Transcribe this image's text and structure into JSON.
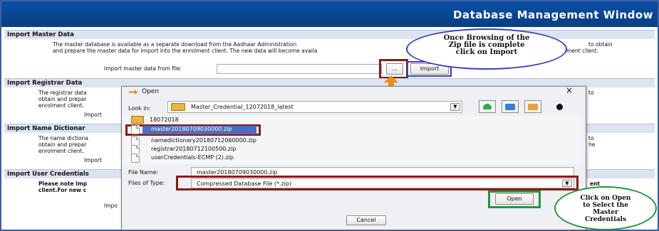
{
  "window": {
    "title": "Database Management Window"
  },
  "sections": {
    "master": {
      "heading": "Import Master Data",
      "desc1": "The master database is available as a separate download from the Aadhaar Administration",
      "desc1b": "to obtain",
      "desc2": "and prepare the master data for import into the enrolment client. The new data will become availa",
      "desc2b": "lment client.",
      "label": "Import master data from file:",
      "browse_label": "...",
      "import_label": "Import"
    },
    "registrar": {
      "heading": "Import Registrar Data",
      "desc1": "The registrar data",
      "desc2": "obtain and prepar",
      "desc3": "enrolment client.",
      "tail1": "to",
      "label": "Import"
    },
    "namedict": {
      "heading": "Import Name Dictionar",
      "desc1": "The name dictiona",
      "desc2": "obtain and prepar",
      "desc3": "enrolment client.",
      "tail1": "to",
      "tail2": "he",
      "label": "Import"
    },
    "usercred": {
      "heading": "Import User Credentials",
      "desc1": "Please note Imp",
      "desc2": "client.For new c",
      "tail1": "ent",
      "tail2": "ent",
      "label": "Impo"
    }
  },
  "dialog": {
    "title": "Open",
    "close": "×",
    "look_in_label": "Look in:",
    "look_in_value": "Master_Credential_12072018_latest",
    "folder": "18072018",
    "files": [
      "master20180709030000.zip",
      "namedictionary20180712060000.zip",
      "registrar20180712100500.zip",
      "userCredentials-ECMP (2).zip"
    ],
    "file_name_label": "File Name:",
    "file_name_value": "master20180709030000.zip",
    "files_of_type_label": "Files of Type:",
    "files_of_type_value": "Compressed Database File (*.zip)",
    "open_label": "Open",
    "cancel_label": "Cancel"
  },
  "callouts": {
    "top": [
      "Once Browsing of the",
      "Zip file is complete",
      "click on Import"
    ],
    "bottom": [
      "Click on Open",
      "to Select the",
      "Master",
      "Credentials"
    ]
  },
  "colors": {
    "titlebar": "#0b4ea8",
    "highlight": "#8b1a1a",
    "callout_border": "#1f9a34",
    "callout_top_border": "#3a3fb8"
  }
}
